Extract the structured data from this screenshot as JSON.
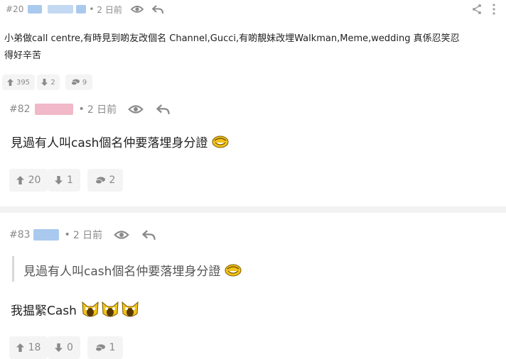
{
  "posts": [
    {
      "number": "#20",
      "time": "2 日前",
      "body_line1": "小弟做call centre,有時見到啲友改個名 Channel,Gucci,有啲靚妹改埋Walkman,Meme,wedding 真係忍笑忍",
      "body_line2": "得好辛苦",
      "likes": "395",
      "dislikes": "2",
      "replies": "9"
    },
    {
      "number": "#82",
      "time": "2 日前",
      "body": "見過有人叫cash個名仲要落埋身分證",
      "likes": "20",
      "dislikes": "1",
      "replies": "2"
    },
    {
      "number": "#83",
      "time": "2 日前",
      "quote": "見過有人叫cash個名仲要落埋身分證",
      "body": "我揾緊Cash",
      "likes": "18",
      "dislikes": "0",
      "replies": "1"
    }
  ],
  "separator_dot": "•",
  "colors": {
    "muted": "#8a8a8a",
    "button_bg": "#f4f4f4",
    "separator": "#f2f2f2",
    "blur_pink": "#f0b8c8",
    "blur_blue": "#a9c9ee",
    "emoji": "#f2c21a"
  }
}
